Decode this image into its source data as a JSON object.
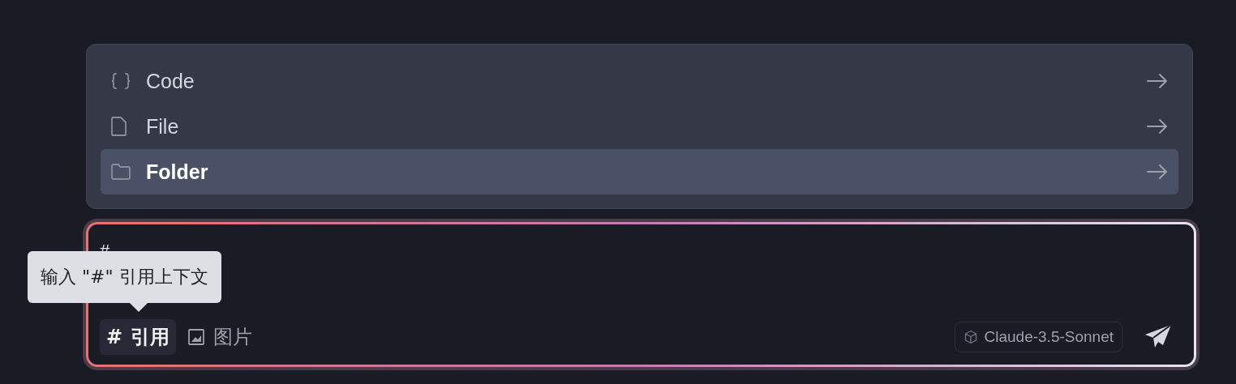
{
  "menu": {
    "items": [
      {
        "kind": "code",
        "label": "Code",
        "selected": false
      },
      {
        "kind": "file",
        "label": "File",
        "selected": false
      },
      {
        "kind": "folder",
        "label": "Folder",
        "selected": true
      }
    ]
  },
  "composer": {
    "value": "#",
    "tooltip": "输入 \"#\" 引用上下文",
    "tools": [
      {
        "kind": "mention",
        "icon": "#",
        "label": "引用",
        "selected": true
      },
      {
        "kind": "image",
        "label": "图片",
        "selected": false
      }
    ],
    "model": "Claude-3.5-Sonnet"
  }
}
